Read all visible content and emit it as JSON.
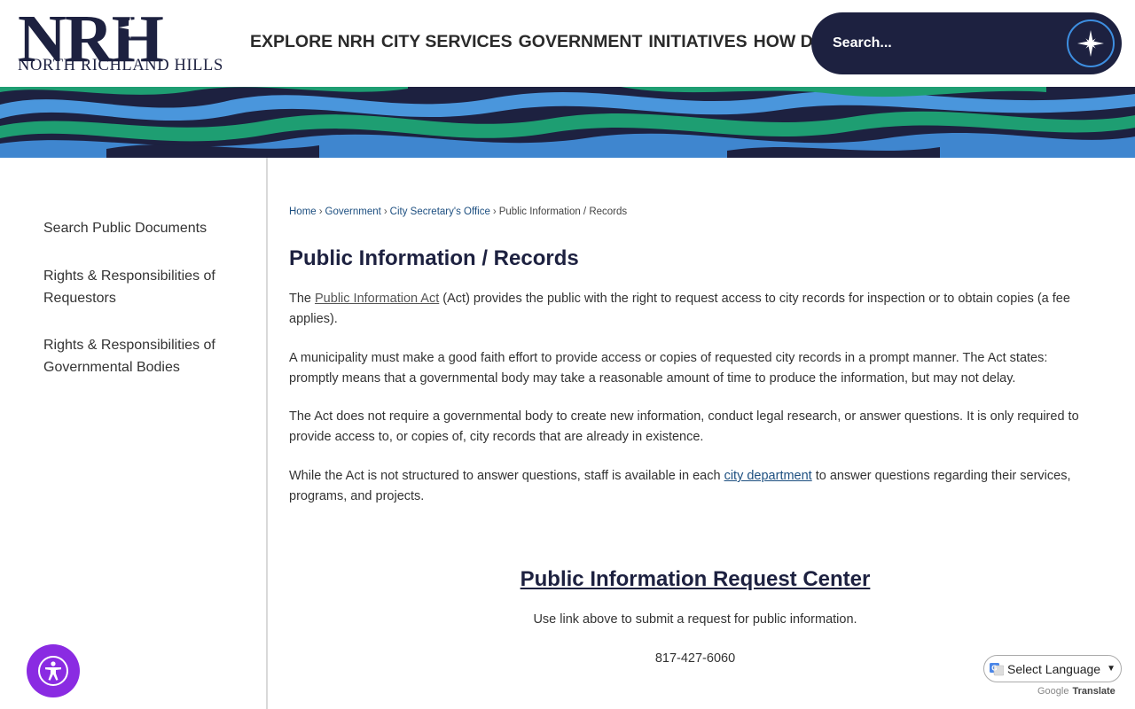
{
  "header": {
    "logo_letters": "NRH",
    "logo_subtitle": "NORTH RICHLAND HILLS",
    "nav": [
      "EXPLORE NRH",
      "CITY SERVICES",
      "GOVERNMENT",
      "INITIATIVES",
      "HOW DO I"
    ],
    "search_placeholder": "Search..."
  },
  "sidebar": {
    "items": [
      {
        "label": "Search Public Documents"
      },
      {
        "label": "Rights & Responsibilities of Requestors"
      },
      {
        "label": "Rights & Responsibilities of Governmental Bodies"
      }
    ]
  },
  "breadcrumb": {
    "home": "Home",
    "government": "Government",
    "office": "City Secretary's Office",
    "current": "Public Information / Records"
  },
  "main": {
    "title": "Public Information / Records",
    "p1_pre": "The ",
    "p1_link": "Public Information Act",
    "p1_post": " (Act) provides the public with the right to request access to city records for inspection or to obtain copies (a fee applies).",
    "p2": "A municipality must make a good faith effort to provide access or copies of requested city records in a prompt manner.  The Act states: promptly means that a governmental body may take a reasonable amount of time to produce the information, but may not delay.",
    "p3": "The Act does not require a governmental body to create new information, conduct legal research, or answer questions. It is only required to provide access to, or copies of, city records that are already in existence.",
    "p4_pre": "While the Act is not structured to answer questions, staff is available in each ",
    "p4_link": "city department",
    "p4_post": " to answer questions regarding their services, programs, and projects.",
    "request_center_link": "Public Information Request Center",
    "request_center_note": "Use link above to submit a request for public information.",
    "phone": "817-427-6060"
  },
  "translate": {
    "select_label": "Select Language",
    "powered_google": "Google",
    "powered_translate": "Translate"
  },
  "colors": {
    "navy": "#1d2140",
    "accent_blue": "#3d8ee0",
    "accessibility_purple": "#8a2be2",
    "link_blue": "#1d4f80"
  }
}
